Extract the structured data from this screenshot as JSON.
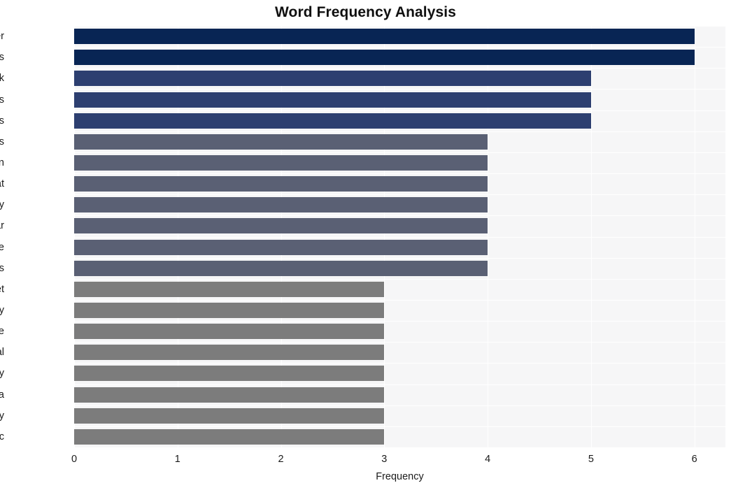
{
  "chart_data": {
    "type": "bar",
    "orientation": "horizontal",
    "title": "Word Frequency Analysis",
    "xlabel": "Frequency",
    "ylabel": "",
    "xlim": [
      0,
      6.3
    ],
    "xticks": [
      0,
      1,
      2,
      3,
      4,
      5,
      6
    ],
    "xtick_labels": [
      "0",
      "1",
      "2",
      "3",
      "4",
      "5",
      "6"
    ],
    "grid": true,
    "legend": null,
    "categories": [
      "cyber",
      "credentials",
      "network",
      "devices",
      "routers",
      "users",
      "russian",
      "threat",
      "fancy",
      "bear",
      "compromise",
      "edgerouters",
      "target",
      "advisory",
      "include",
      "national",
      "security",
      "nsa",
      "proxy",
      "traffic"
    ],
    "values": [
      6,
      6,
      5,
      5,
      5,
      4,
      4,
      4,
      4,
      4,
      4,
      4,
      3,
      3,
      3,
      3,
      3,
      3,
      3,
      3
    ],
    "bar_colors": [
      "#082554",
      "#082554",
      "#2d3f70",
      "#2d3f70",
      "#2d3f70",
      "#5a6074",
      "#5a6074",
      "#5a6074",
      "#5a6074",
      "#5a6074",
      "#5a6074",
      "#5a6074",
      "#7c7c7c",
      "#7c7c7c",
      "#7c7c7c",
      "#7c7c7c",
      "#7c7c7c",
      "#7c7c7c",
      "#7c7c7c",
      "#7c7c7c"
    ]
  },
  "style": {
    "plot_background": "#f6f6f7",
    "grid_color": "#ffffff",
    "figure_background": "#ffffff",
    "text_color": "#1b1b1b",
    "title_color": "#101010"
  }
}
